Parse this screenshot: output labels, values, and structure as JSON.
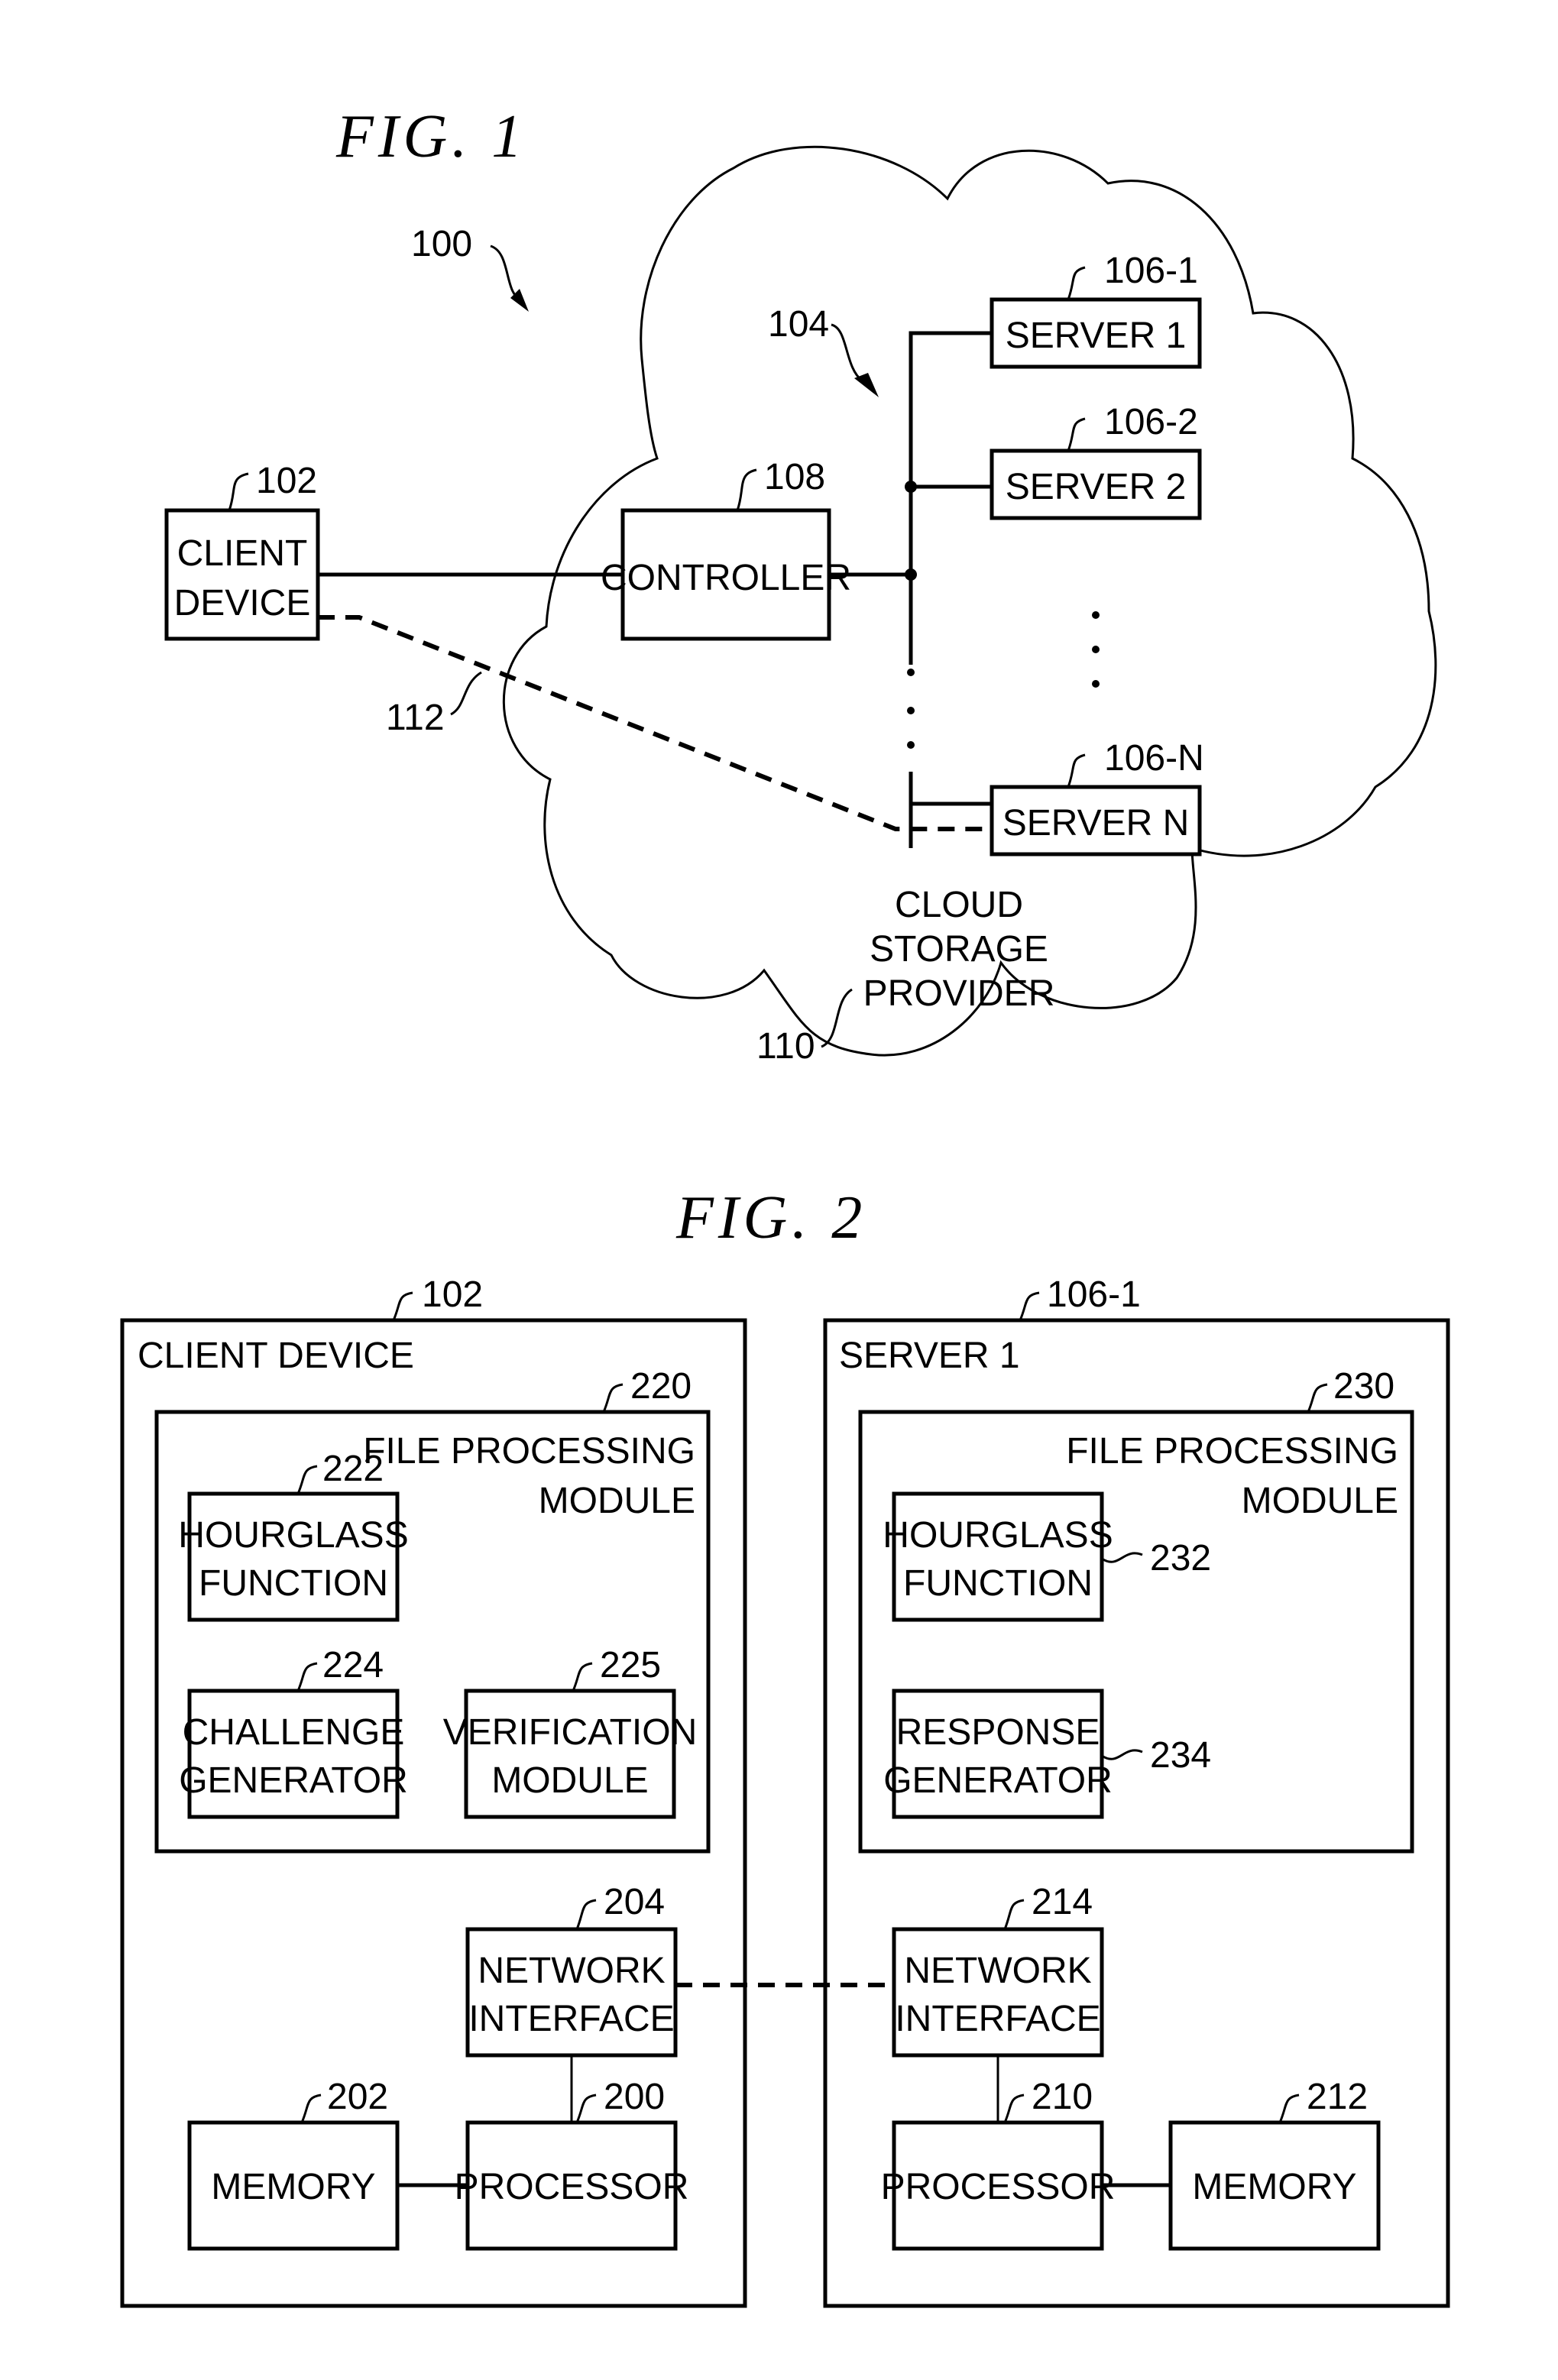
{
  "fig1": {
    "title": "FIG. 1",
    "system_ref": "100",
    "network_ref": "104",
    "client": {
      "ref": "102",
      "line1": "CLIENT",
      "line2": "DEVICE"
    },
    "controller": {
      "ref": "108",
      "label": "CONTROLLER"
    },
    "servers": [
      {
        "ref": "106-1",
        "label": "SERVER 1"
      },
      {
        "ref": "106-2",
        "label": "SERVER 2"
      },
      {
        "ref": "106-N",
        "label": "SERVER N"
      }
    ],
    "link_ref": "112",
    "cloud": {
      "ref": "110",
      "line1": "CLOUD",
      "line2": "STORAGE",
      "line3": "PROVIDER"
    }
  },
  "fig2": {
    "title": "FIG. 2",
    "client": {
      "ref": "102",
      "label": "CLIENT DEVICE",
      "module": {
        "ref": "220",
        "line1": "FILE PROCESSING",
        "line2": "MODULE"
      },
      "hourglass": {
        "ref": "222",
        "line1": "HOURGLASS",
        "line2": "FUNCTION"
      },
      "challenge": {
        "ref": "224",
        "line1": "CHALLENGE",
        "line2": "GENERATOR"
      },
      "verification": {
        "ref": "225",
        "line1": "VERIFICATION",
        "line2": "MODULE"
      },
      "network": {
        "ref": "204",
        "line1": "NETWORK",
        "line2": "INTERFACE"
      },
      "memory": {
        "ref": "202",
        "label": "MEMORY"
      },
      "processor": {
        "ref": "200",
        "label": "PROCESSOR"
      }
    },
    "server": {
      "ref": "106-1",
      "label": "SERVER 1",
      "module": {
        "ref": "230",
        "line1": "FILE PROCESSING",
        "line2": "MODULE"
      },
      "hourglass": {
        "ref": "232",
        "line1": "HOURGLASS",
        "line2": "FUNCTION"
      },
      "response": {
        "ref": "234",
        "line1": "RESPONSE",
        "line2": "GENERATOR"
      },
      "network": {
        "ref": "214",
        "line1": "NETWORK",
        "line2": "INTERFACE"
      },
      "processor": {
        "ref": "210",
        "label": "PROCESSOR"
      },
      "memory": {
        "ref": "212",
        "label": "MEMORY"
      }
    }
  }
}
